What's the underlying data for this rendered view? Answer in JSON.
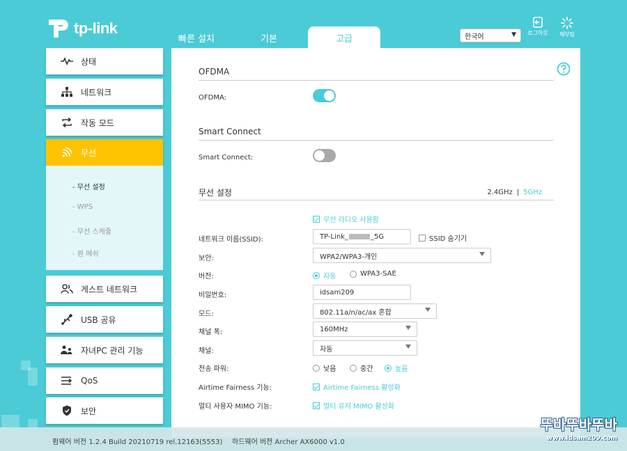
{
  "brand": {
    "logo_text": "tp-link",
    "accent": "#4acbd6",
    "active_menu": "#fec300"
  },
  "tabs": [
    {
      "label": "빠른 설치",
      "active": false
    },
    {
      "label": "기본",
      "active": false
    },
    {
      "label": "고급",
      "active": true
    }
  ],
  "header": {
    "language": "한국어",
    "logout_label": "로그아웃",
    "reboot_label": "재부팅"
  },
  "sidebar": {
    "items": [
      {
        "label": "상태",
        "icon": "pulse-icon"
      },
      {
        "label": "네트워크",
        "icon": "network-icon"
      },
      {
        "label": "작동 모드",
        "icon": "mode-icon"
      },
      {
        "label": "무선",
        "icon": "wifi-icon",
        "active": true
      },
      {
        "label": "게스트 네트워크",
        "icon": "guest-icon"
      },
      {
        "label": "USB 공유",
        "icon": "usb-icon"
      },
      {
        "label": "자녀PC 관리 기능",
        "icon": "parental-icon"
      },
      {
        "label": "QoS",
        "icon": "qos-icon"
      },
      {
        "label": "보안",
        "icon": "shield-icon"
      }
    ],
    "submenu": [
      {
        "label": "- 무선 설정",
        "active": true
      },
      {
        "label": "- WPS",
        "active": false
      },
      {
        "label": "- 무선 스케줄",
        "active": false
      },
      {
        "label": "- 원 메쉬",
        "active": false
      }
    ]
  },
  "main": {
    "ofdma": {
      "section_title": "OFDMA",
      "label": "OFDMA:",
      "enabled": true
    },
    "smart_connect": {
      "section_title": "Smart Connect",
      "label": "Smart Connect:",
      "enabled": false
    },
    "wireless": {
      "section_title": "무선 설정",
      "band_24": "2.4GHz",
      "band_sep": "|",
      "band_5": "5GHz",
      "enable_radio_label": "무선 라디오 사용함",
      "ssid_label": "네트워크 이름(SSID):",
      "ssid_prefix": "TP-Link_",
      "ssid_suffix": "_5G",
      "hide_ssid_label": "SSID 숨기기",
      "security_label": "보안:",
      "security_value": "WPA2/WPA3-개인",
      "version_label": "버전:",
      "version_auto": "자동",
      "version_sae": "WPA3-SAE",
      "password_label": "비밀번호:",
      "password_value": "idsam209",
      "mode_label": "모드:",
      "mode_value": "802.11a/n/ac/ax 혼합",
      "width_label": "채널 폭:",
      "width_value": "160MHz",
      "channel_label": "채널:",
      "channel_value": "자동",
      "power_label": "전송 파워:",
      "power_low": "낮음",
      "power_mid": "중간",
      "power_high": "높음",
      "atf_label": "Airtime Fairness 기능:",
      "atf_value": "Airtime Fairness 활성화",
      "mumimo_label": "멀티 사용자 MIMO 기능:",
      "mumimo_value": "멀티 유저 MIMO 활성화"
    }
  },
  "footer": {
    "firmware": "펌웨어 버전 1.2.4 Build 20210719 rel.12163(5553)",
    "hardware": "하드웨어 버전 Archer AX6000 v1.0"
  },
  "watermark": {
    "text": "뚜바뚜바뚜바",
    "url": "www.idsam209.com"
  }
}
